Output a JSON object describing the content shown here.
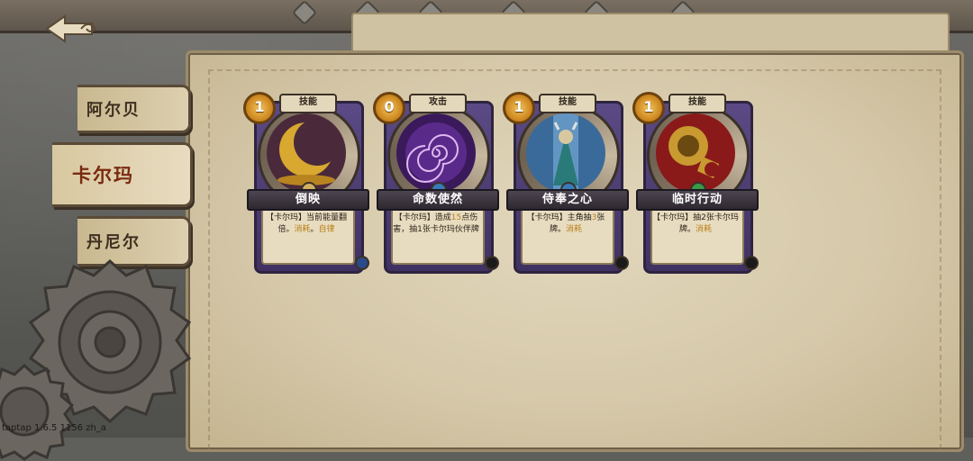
{
  "header": {
    "back_icon": "back-arrow-icon"
  },
  "tabs": [
    {
      "label": "阿尔贝",
      "selected": false
    },
    {
      "label": "卡尔玛",
      "selected": true
    },
    {
      "label": "丹尼尔",
      "selected": false
    }
  ],
  "cards": [
    {
      "cost": "1",
      "type": "技能",
      "name": "倒映",
      "desc_a": "【卡尔玛】当前能量翻倍。",
      "desc_kw1": "消耗",
      "desc_sep": "。",
      "desc_kw2": "自律",
      "art": "crescent-moon-icon"
    },
    {
      "cost": "0",
      "type": "攻击",
      "name": "命数使然",
      "desc_a": "【卡尔玛】造成",
      "desc_num": "15",
      "desc_b": "点伤害，抽1张卡尔玛伙伴牌",
      "art": "spiral-clock-icon"
    },
    {
      "cost": "1",
      "type": "技能",
      "name": "侍奉之心",
      "desc_a": "【卡尔玛】主角抽",
      "desc_num": "3",
      "desc_b": "张牌。",
      "desc_kw1": "消耗",
      "art": "hooded-figure-icon"
    },
    {
      "cost": "1",
      "type": "技能",
      "name": "临时行动",
      "desc_a": "【卡尔玛】抽2张卡尔玛牌。",
      "desc_kw1": "消耗",
      "art": "brass-horn-icon"
    }
  ],
  "footer": {
    "version": "taptap 1.6.5 1156 zh_a"
  },
  "colors": {
    "paper": "#d6c9aa",
    "card_frame": "#4d3e75",
    "keyword": "#b8801a",
    "selected_tab_text": "#7a2a10"
  }
}
